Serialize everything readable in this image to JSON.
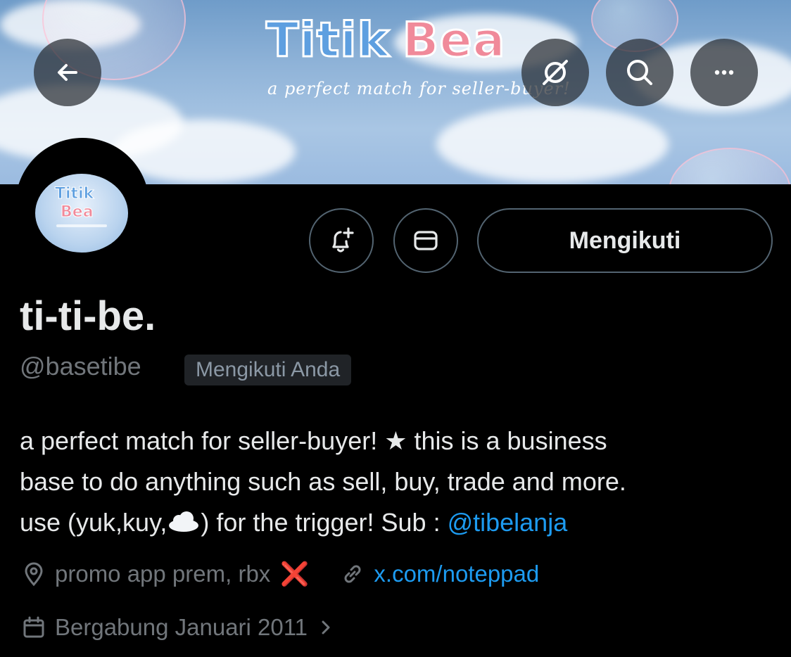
{
  "banner": {
    "title_part1": "Titik",
    "title_part2": "Bea",
    "subtitle": "a perfect match for seller-buyer!"
  },
  "avatar": {
    "line1": "Titik",
    "line2": "Bea"
  },
  "actions": {
    "follow_label": "Mengikuti"
  },
  "profile": {
    "display_name": "ti-ti-be.",
    "handle": "@basetibe",
    "follows_you_badge": "Mengikuti Anda",
    "bio": {
      "line1": "a perfect match for seller-buyer! ★ this is a business",
      "line2": "base to do anything such as sell, buy, trade and more.",
      "line3_before": "use (yuk,kuy,",
      "line3_after": ") for the trigger! Sub : ",
      "mention": "@tibelanja"
    },
    "location": "promo app prem, rbx",
    "location_suffix": "❌",
    "website": "x.com/noteppad",
    "joined": "Bergabung Januari 2011"
  },
  "icons": {
    "back": "back-arrow-icon",
    "grok": "grok-icon",
    "search": "search-icon",
    "more": "more-icon",
    "notify": "bell-plus-icon",
    "message": "envelope-icon",
    "location": "location-pin-icon",
    "link": "link-icon",
    "calendar": "calendar-icon",
    "chevron": "chevron-right-icon",
    "cloud": "cloud-emoji"
  },
  "colors": {
    "accent": "#1d9bf0",
    "muted": "#71767b",
    "text": "#e7e9ea",
    "background": "#000000",
    "badge_bg": "#202327",
    "x_mark": "#e0245e"
  }
}
